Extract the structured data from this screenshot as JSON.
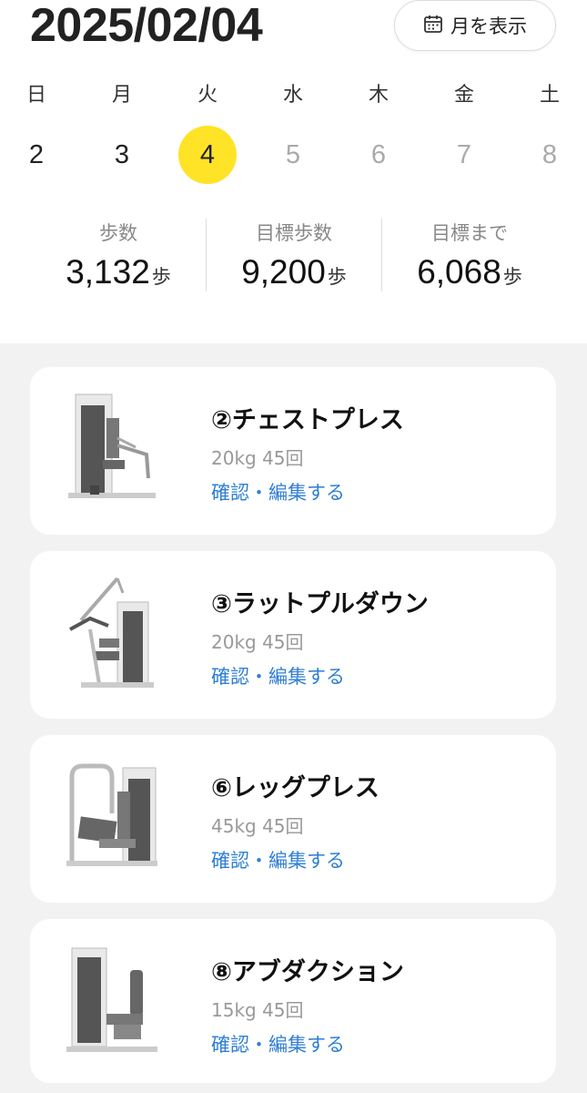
{
  "header": {
    "date": "2025/02/04",
    "month_button_label": "月を表示",
    "month_button_icon": "calendar-icon"
  },
  "week": {
    "weekdays": [
      "日",
      "月",
      "火",
      "水",
      "木",
      "金",
      "土"
    ],
    "days": [
      "2",
      "3",
      "4",
      "5",
      "6",
      "7",
      "8"
    ],
    "selected_index": 2,
    "selected_color": "#ffe327"
  },
  "stats": [
    {
      "label": "歩数",
      "value": "3,132",
      "unit": "歩"
    },
    {
      "label": "目標歩数",
      "value": "9,200",
      "unit": "歩"
    },
    {
      "label": "目標まで",
      "value": "6,068",
      "unit": "歩"
    }
  ],
  "exercises": [
    {
      "title": "②チェストプレス",
      "detail": "20kg 45回",
      "link": "確認・編集する",
      "machine_icon": "chest-press-machine-image"
    },
    {
      "title": "③ラットプルダウン",
      "detail": "20kg 45回",
      "link": "確認・編集する",
      "machine_icon": "lat-pulldown-machine-image"
    },
    {
      "title": "⑥レッグプレス",
      "detail": "45kg 45回",
      "link": "確認・編集する",
      "machine_icon": "leg-press-machine-image"
    },
    {
      "title": "⑧アブダクション",
      "detail": "15kg 45回",
      "link": "確認・編集する",
      "machine_icon": "abduction-machine-image"
    }
  ],
  "colors": {
    "link": "#2f7fd2",
    "background_list": "#f2f2f2"
  }
}
